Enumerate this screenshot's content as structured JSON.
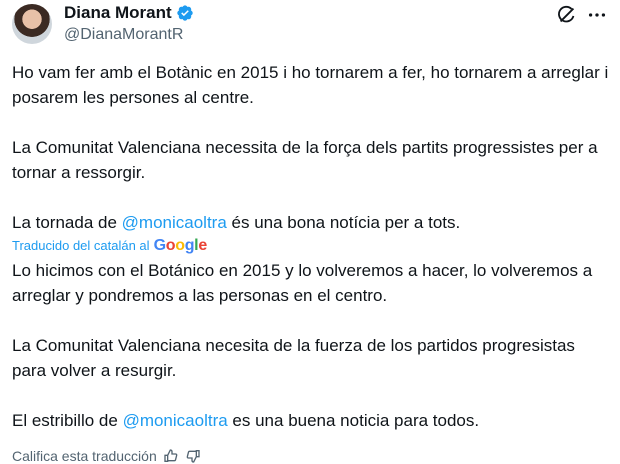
{
  "author": {
    "name": "Diana Morant",
    "handle": "@DianaMorantR",
    "verified_color": "#1d9bf0"
  },
  "original": {
    "p1": "Ho vam fer amb el Botànic en 2015 i ho tornarem a fer, ho tornarem a arreglar i posarem les persones al centre.",
    "p2": "La Comunitat Valenciana necessita de la força dels partits progressistes per a tornar a ressorgir.",
    "p3_before": "La tornada de ",
    "p3_mention": "@monicaoltra",
    "p3_after": " és una bona notícia per a tots."
  },
  "translation": {
    "label": "Traducido del catalán al",
    "provider": "Google",
    "p1": "Lo hicimos con el Botánico en 2015 y lo volveremos a hacer, lo volveremos a arreglar y pondremos a las personas en el centro.",
    "p2": "La Comunitat Valenciana necesita de la fuerza de los partidos progresistas para volver a resurgir.",
    "p3_before": "El estribillo de ",
    "p3_mention": "@monicaoltra",
    "p3_after": " es una buena noticia para todos."
  },
  "rate": {
    "label": "Califica esta traducción"
  },
  "icons": {
    "grok": "grok-icon",
    "more": "more-icon",
    "verified": "verified-badge-icon",
    "thumbs_up": "thumbs-up-icon",
    "thumbs_down": "thumbs-down-icon"
  }
}
